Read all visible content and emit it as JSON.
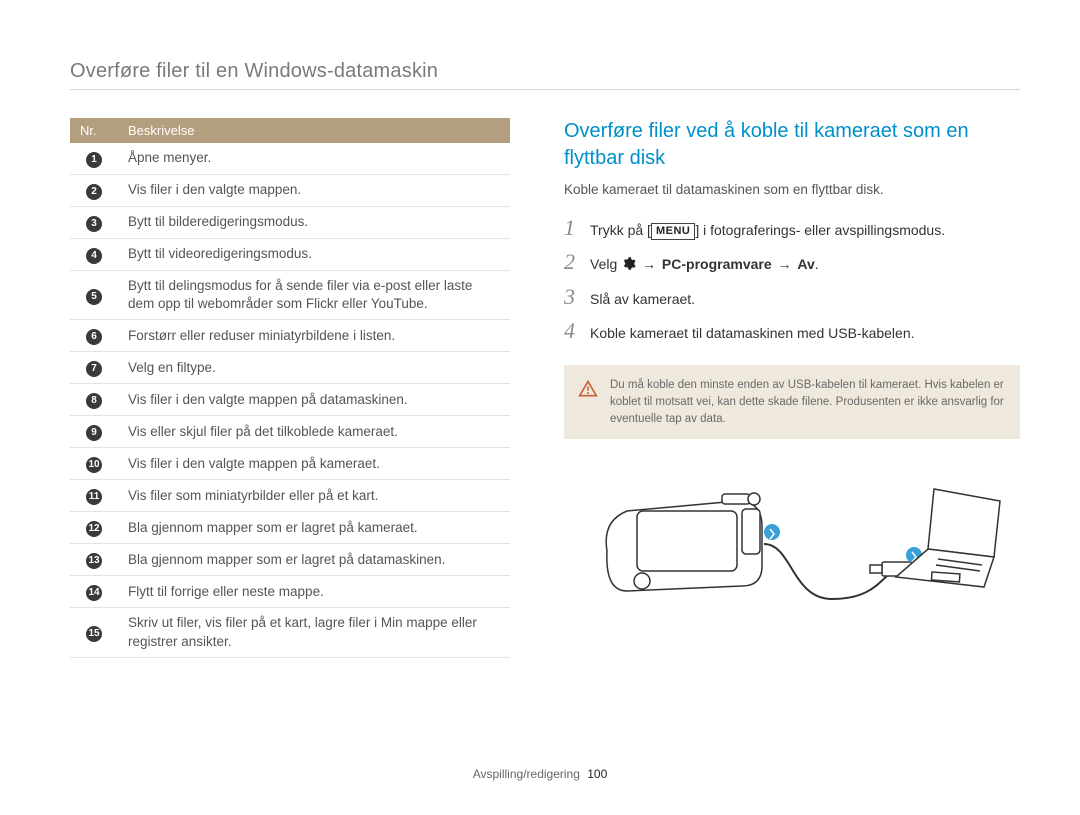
{
  "page_title": "Overføre filer til en Windows-datamaskin",
  "table": {
    "header_nr": "Nr.",
    "header_desc": "Beskrivelse",
    "rows": [
      "Åpne menyer.",
      "Vis filer i den valgte mappen.",
      "Bytt til bilderedigeringsmodus.",
      "Bytt til videoredigeringsmodus.",
      "Bytt til delingsmodus for å sende filer via e-post eller laste dem opp til webområder som Flickr eller YouTube.",
      "Forstørr eller reduser miniatyrbildene i listen.",
      "Velg en filtype.",
      "Vis filer i den valgte mappen på datamaskinen.",
      "Vis eller skjul filer på det tilkoblede kameraet.",
      "Vis filer i den valgte mappen på kameraet.",
      "Vis filer som miniatyrbilder eller på et kart.",
      "Bla gjennom mapper som er lagret på kameraet.",
      "Bla gjennom mapper som er lagret på datamaskinen.",
      "Flytt til forrige eller neste mappe.",
      "Skriv ut filer, vis filer på et kart, lagre filer i Min mappe eller registrer ansikter."
    ]
  },
  "section": {
    "heading": "Overføre filer ved å koble til kameraet som en flyttbar disk",
    "intro": "Koble kameraet til datamaskinen som en flyttbar disk.",
    "step1_pre": "Trykk på [",
    "step1_menu": "MENU",
    "step1_post": "] i fotograferings- eller avspillingsmodus.",
    "step2_pre": "Velg ",
    "step2_bold_1": "PC-programvare",
    "step2_bold_2": "Av",
    "step2_period": ".",
    "step3": "Slå av kameraet.",
    "step4": "Koble kameraet til datamaskinen med USB-kabelen."
  },
  "note": "Du må koble den minste enden av USB-kabelen til kameraet. Hvis kabelen er koblet til motsatt vei, kan dette skade filene. Produsenten er ikke ansvarlig for eventuelle tap av data.",
  "footer_label": "Avspilling/redigering",
  "footer_page": "100"
}
